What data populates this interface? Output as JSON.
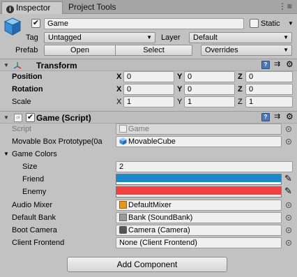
{
  "tabs": {
    "inspector": "Inspector",
    "project_tools": "Project Tools",
    "menu": "⋮≡"
  },
  "game_object": {
    "active": true,
    "name": "Game",
    "static_label": "Static",
    "static_checked": false,
    "tag_label": "Tag",
    "tag_value": "Untagged",
    "layer_label": "Layer",
    "layer_value": "Default",
    "prefab_label": "Prefab",
    "prefab_open": "Open",
    "prefab_select": "Select",
    "prefab_overrides": "Overrides"
  },
  "transform": {
    "title": "Transform",
    "rows": [
      {
        "label": "Position",
        "x": "0",
        "y": "0",
        "z": "0"
      },
      {
        "label": "Rotation",
        "x": "0",
        "y": "0",
        "z": "0"
      },
      {
        "label": "Scale",
        "x": "1",
        "y": "1",
        "z": "1"
      }
    ],
    "axis_x": "X",
    "axis_y": "Y",
    "axis_z": "Z"
  },
  "script_component": {
    "title": "Game (Script)",
    "enabled": true,
    "script_label": "Script",
    "script_value": "Game",
    "movable_label": "Movable Box Prototype(0a",
    "movable_value": "MovableCube",
    "game_colors_label": "Game Colors",
    "size_label": "Size",
    "size_value": "2",
    "friend_label": "Friend",
    "friend_color": "#1f86c9",
    "enemy_label": "Enemy",
    "enemy_color": "#f04040",
    "audio_mixer_label": "Audio Mixer",
    "audio_mixer_value": "DefaultMixer",
    "default_bank_label": "Default Bank",
    "default_bank_value": "Bank (SoundBank)",
    "boot_camera_label": "Boot Camera",
    "boot_camera_value": "Camera (Camera)",
    "client_frontend_label": "Client Frontend",
    "client_frontend_value": "None (Client Frontend)"
  },
  "add_component": "Add Component"
}
